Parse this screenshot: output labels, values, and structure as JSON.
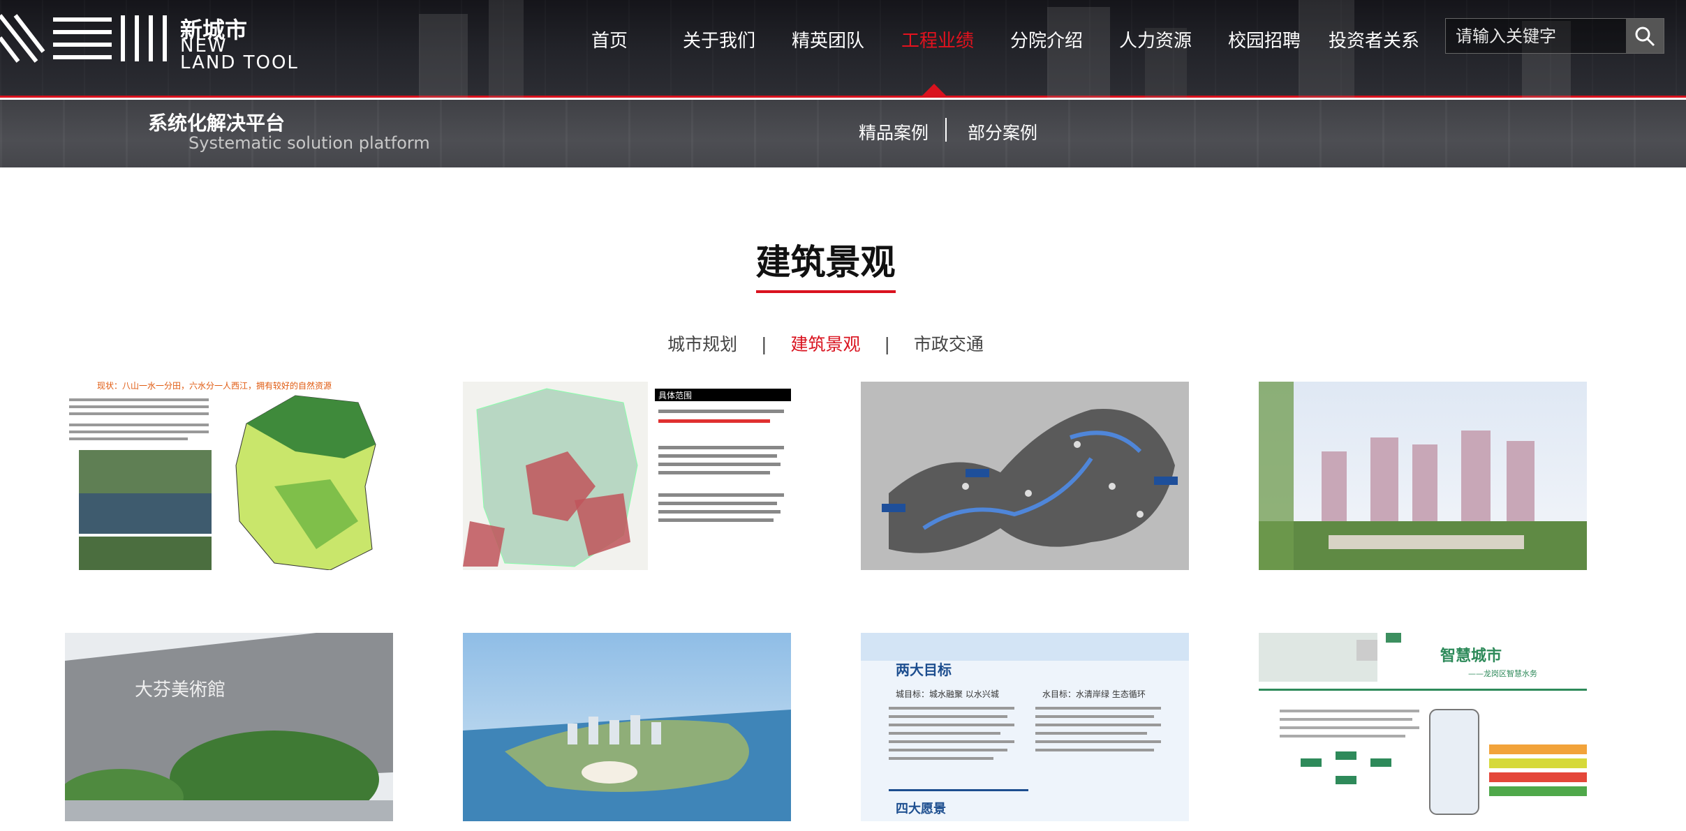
{
  "header": {
    "logo_cn": "新城市",
    "logo_en_line1": "NEW",
    "logo_en_line2": "LAND TOOL",
    "nav": [
      {
        "label": "首页",
        "active": false
      },
      {
        "label": "关于我们",
        "active": false
      },
      {
        "label": "精英团队",
        "active": false
      },
      {
        "label": "工程业绩",
        "active": true
      },
      {
        "label": "分院介绍",
        "active": false
      },
      {
        "label": "人力资源",
        "active": false
      },
      {
        "label": "校园招聘",
        "active": false
      },
      {
        "label": "投资者关系",
        "active": false
      }
    ],
    "search": {
      "placeholder": "请输入关键字",
      "icon": "search-icon"
    }
  },
  "subbar": {
    "title": "系统化解决平台",
    "title_en": "Systematic solution platform",
    "links": [
      "精品案例",
      "部分案例"
    ]
  },
  "section": {
    "title": "建筑景观",
    "filters": [
      {
        "label": "城市规划",
        "active": false
      },
      {
        "label": "建筑景观",
        "active": true
      },
      {
        "label": "市政交通",
        "active": false
      }
    ]
  },
  "cards": [
    {
      "kind": "map-collage",
      "heading": "现状：八山一水一分田，六水分一人西江，拥有较好的自然资源"
    },
    {
      "kind": "district-map",
      "heading": "具体范围"
    },
    {
      "kind": "gray-map"
    },
    {
      "kind": "towers"
    },
    {
      "kind": "museum",
      "sign": "大芬美術館"
    },
    {
      "kind": "aerial"
    },
    {
      "kind": "text-panel",
      "heading": "两大目标",
      "heading2": "四大愿景",
      "left": "城目标：城水融聚  以水兴城",
      "right": "水目标：水清岸绿  生态循环"
    },
    {
      "kind": "smart-city",
      "heading": "智慧城市",
      "subheading": "——龙岗区智慧水务"
    }
  ],
  "colors": {
    "accent": "#d9121e",
    "header_bg": "#1c1d22",
    "subbar_bg": "#48494e"
  }
}
